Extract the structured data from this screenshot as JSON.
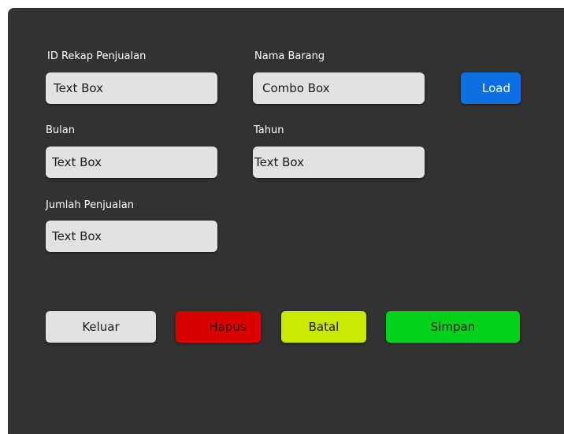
{
  "form": {
    "id_label": "ID Rekap Penjualan",
    "id_value": "Text Box",
    "nama_label": "Nama Barang",
    "nama_value": "Combo Box",
    "load_label": "Load",
    "bulan_label": "Bulan",
    "bulan_value": "Text Box",
    "tahun_label": "Tahun",
    "tahun_value": "Text Box",
    "jumlah_label": "Jumlah Penjualan",
    "jumlah_value": "Text Box"
  },
  "actions": {
    "keluar_label": "Keluar",
    "hapus_label": "Hapus",
    "batal_label": "Batal",
    "simpan_label": "Simpan"
  },
  "colors": {
    "panel_background": "#323232",
    "field_background": "#e2e2e2",
    "load_button": "#0a6fe0",
    "keluar_button": "#e2e2e2",
    "hapus_button": "#d90000",
    "batal_button": "#c9e800",
    "simpan_button": "#00d21a"
  }
}
